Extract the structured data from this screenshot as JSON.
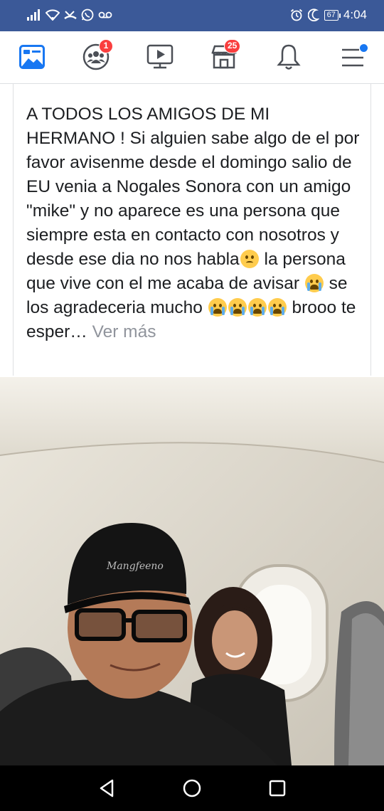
{
  "status_bar": {
    "time": "4:04",
    "battery": "67",
    "icons": [
      "signal-icon",
      "wifi-icon",
      "missed-call-icon",
      "whatsapp-icon",
      "voicemail-icon",
      "alarm-icon",
      "moon-icon"
    ]
  },
  "nav": {
    "items": [
      {
        "name": "news-feed",
        "icon": "news-feed-icon"
      },
      {
        "name": "groups",
        "icon": "groups-icon",
        "badge": "1"
      },
      {
        "name": "watch",
        "icon": "watch-icon"
      },
      {
        "name": "marketplace",
        "icon": "marketplace-icon",
        "badge": "25"
      },
      {
        "name": "notifications",
        "icon": "bell-icon"
      },
      {
        "name": "menu",
        "icon": "menu-icon"
      }
    ],
    "colors": {
      "active": "#1877f2",
      "icon": "#4b4f56",
      "badge": "#fa3e3e",
      "header": "#3b5998"
    }
  },
  "post": {
    "text_1": "A TODOS LOS AMIGOS DE MI HERMANO ! Si alguien sabe algo de el por favor avisenme desde el domingo salio de EU venia a Nogales Sonora con un amigo \"mike\" y no aparece es una persona que siempre esta en contacto con nosotros y desde ese dia no nos habla",
    "text_2": " la persona que vive con el me acaba de avisar ",
    "text_3": " se los agradeceria mucho ",
    "text_4": " brooo te esper… ",
    "see_more": "Ver más",
    "emojis": [
      "worried-face-emoji",
      "loudly-crying-face-emoji"
    ]
  },
  "photo": {
    "description_icon": "photo-selfie-airplane",
    "cap_text": "Mangfeeno"
  },
  "system_nav": {
    "icons": [
      "back-icon",
      "home-icon",
      "recents-icon"
    ]
  }
}
